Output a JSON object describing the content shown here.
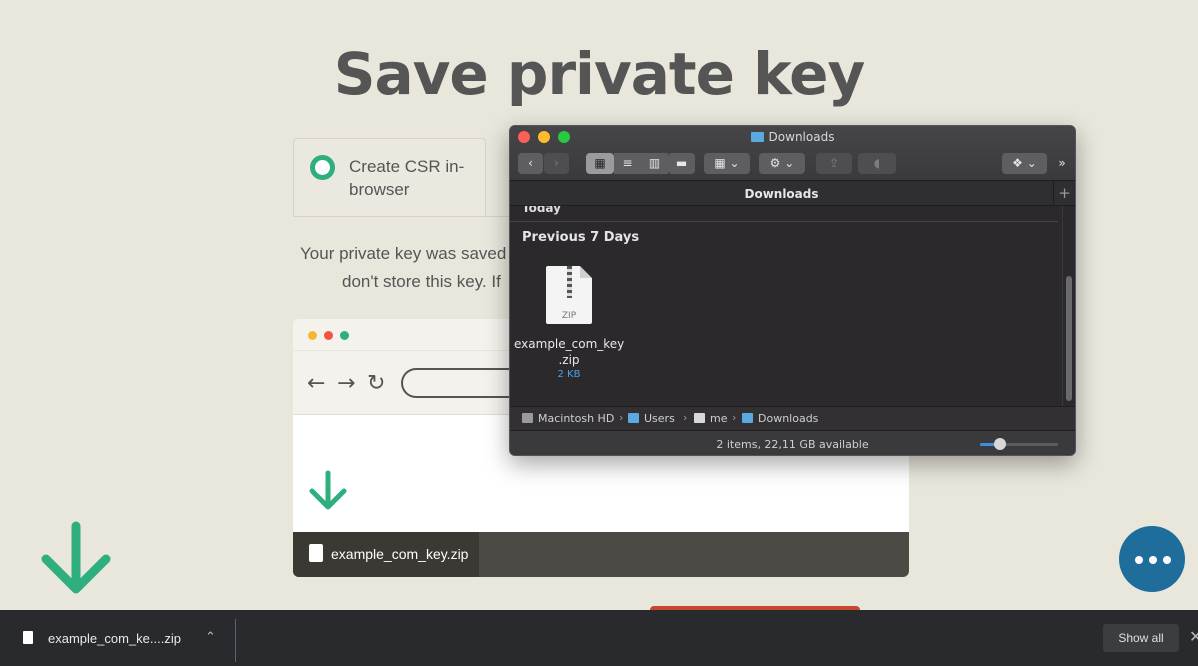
{
  "page": {
    "title": "Save private key",
    "csr_option_label": "Create CSR in-browser",
    "info_line_1": "Your private key was saved",
    "info_line_2": "don't store this key. If"
  },
  "illustration": {
    "download_item": "example_com_key.zip",
    "dot_colors": [
      "#f5b731",
      "#f0563d",
      "#2fae7e"
    ]
  },
  "download_shelf": {
    "file_name": "example_com_ke....zip",
    "show_all": "Show all"
  },
  "finder": {
    "window_title": "Downloads",
    "tab_label": "Downloads",
    "section_today": "Today",
    "section_previous": "Previous 7 Days",
    "file": {
      "name_line1": "example_com_key",
      "name_line2": ".zip",
      "size": "2 KB",
      "icon_label": "ZIP"
    },
    "breadcrumb": [
      "Macintosh HD",
      "Users",
      "me",
      "Downloads"
    ],
    "status": "2 items, 22,11 GB available",
    "icon_size_level": 0.25,
    "traffic_lights": [
      "#fe5f57",
      "#febc2e",
      "#28c840"
    ]
  },
  "colors": {
    "accent_green": "#2fae7e",
    "chat_blue": "#1e6d9b",
    "background": "#e9e7dc"
  }
}
